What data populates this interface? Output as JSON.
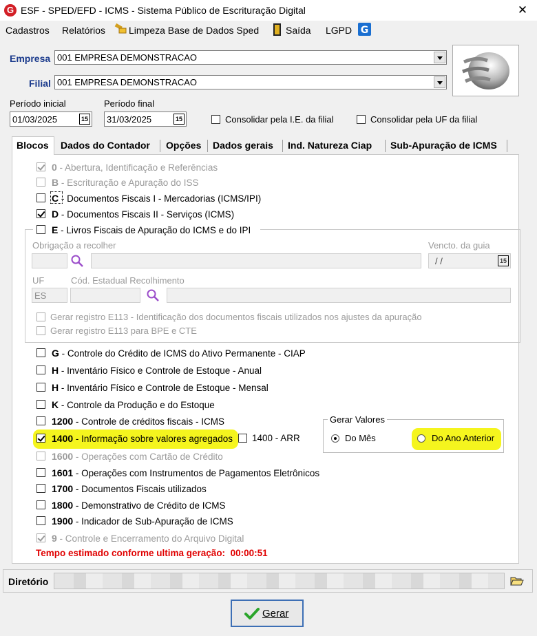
{
  "window": {
    "title": "ESF - SPED/EFD - ICMS - Sistema Público de Escrituração Digital",
    "logo": "G",
    "close": "✕"
  },
  "menu": {
    "cadastros": "Cadastros",
    "relatorios": "Relatórios",
    "limpeza": "Limpeza Base de Dados Sped",
    "saida": "Saída",
    "lgpd": "LGPD"
  },
  "header": {
    "empresa_label": "Empresa",
    "empresa_value": "001 EMPRESA DEMONSTRACAO",
    "filial_label": "Filial",
    "filial_value": "001 EMPRESA DEMONSTRACAO",
    "periodo_inicial_label": "Período inicial",
    "periodo_inicial_value": "01/03/2025",
    "periodo_final_label": "Período final",
    "periodo_final_value": "31/03/2025",
    "calendar_icon_text": "15",
    "consolidar_ie": "Consolidar pela I.E. da filial",
    "consolidar_uf": "Consolidar pela UF da filial"
  },
  "tabs": [
    "Blocos",
    "Dados do Contador",
    "Opções",
    "Dados gerais",
    "Ind. Natureza Ciap",
    "Sub-Apuração de ICMS"
  ],
  "blocos": {
    "b0": {
      "code": "0",
      "text": " - Abertura, Identificação e Referências"
    },
    "bB": {
      "code": "B",
      "text": " - Escrituração e Apuração do ISS"
    },
    "bC": {
      "code": "C",
      "text": " - Documentos Fiscais I - Mercadorias (ICMS/IPI)"
    },
    "bD": {
      "code": "D",
      "text": " - Documentos Fiscais II - Serviços (ICMS)"
    },
    "bE": {
      "code": "E",
      "text": " - Livros Fiscais de Apuração do ICMS e do IPI"
    },
    "obrigacao_label": "Obrigação a recolher",
    "vencto_label": "Vencto. da guia",
    "vencto_value": "/ /",
    "uf_label": "UF",
    "uf_value": "ES",
    "cod_estadual_label": "Cód. Estadual Recolhimento",
    "e113": "Gerar registro E113 - Identificação dos documentos fiscais utilizados nos ajustes da apuração",
    "e113_bpe": "Gerar registro E113 para BPE e CTE",
    "bG": {
      "code": "G",
      "text": " - Controle do Crédito de ICMS do Ativo Permanente - CIAP"
    },
    "bH1": {
      "code": "H",
      "text": " - Inventário Físico e Controle de Estoque - Anual"
    },
    "bH2": {
      "code": "H",
      "text": " - Inventário Físico e Controle de Estoque - Mensal"
    },
    "bK": {
      "code": "K",
      "text": " - Controle da Produção e do Estoque"
    },
    "b1200": {
      "code": "1200",
      "text": " - Controle de créditos fiscais - ICMS"
    },
    "b1400": {
      "code": "1400",
      "text": " - Informação sobre valores agregados"
    },
    "b1400arr": "1400 - ARR",
    "b1600": {
      "code": "1600",
      "text": " - Operações com Cartão de Crédito"
    },
    "b1601": {
      "code": "1601",
      "text": " - Operações com Instrumentos de Pagamentos Eletrônicos"
    },
    "b1700": {
      "code": "1700",
      "text": " - Documentos Fiscais utilizados"
    },
    "b1800": {
      "code": "1800",
      "text": " - Demonstrativo de Crédito de ICMS"
    },
    "b1900": {
      "code": "1900",
      "text": " - Indicador de Sub-Apuração de ICMS"
    },
    "b9": {
      "code": "9",
      "text": " - Controle e Encerramento do Arquivo Digital"
    },
    "gerar_valores_label": "Gerar Valores",
    "do_mes": "Do Mês",
    "do_ano_anterior": "Do Ano Anterior",
    "tempo_label": "Tempo estimado conforme ultima geração:",
    "tempo_value": "00:00:51"
  },
  "footer": {
    "diretorio_label": "Diretório",
    "gerar_label": "Gerar"
  },
  "colors": {
    "title_blue": "#1a3a8c",
    "warning_red": "#e00000",
    "highlight": "#f5f51e",
    "logo_red": "#d32027"
  }
}
